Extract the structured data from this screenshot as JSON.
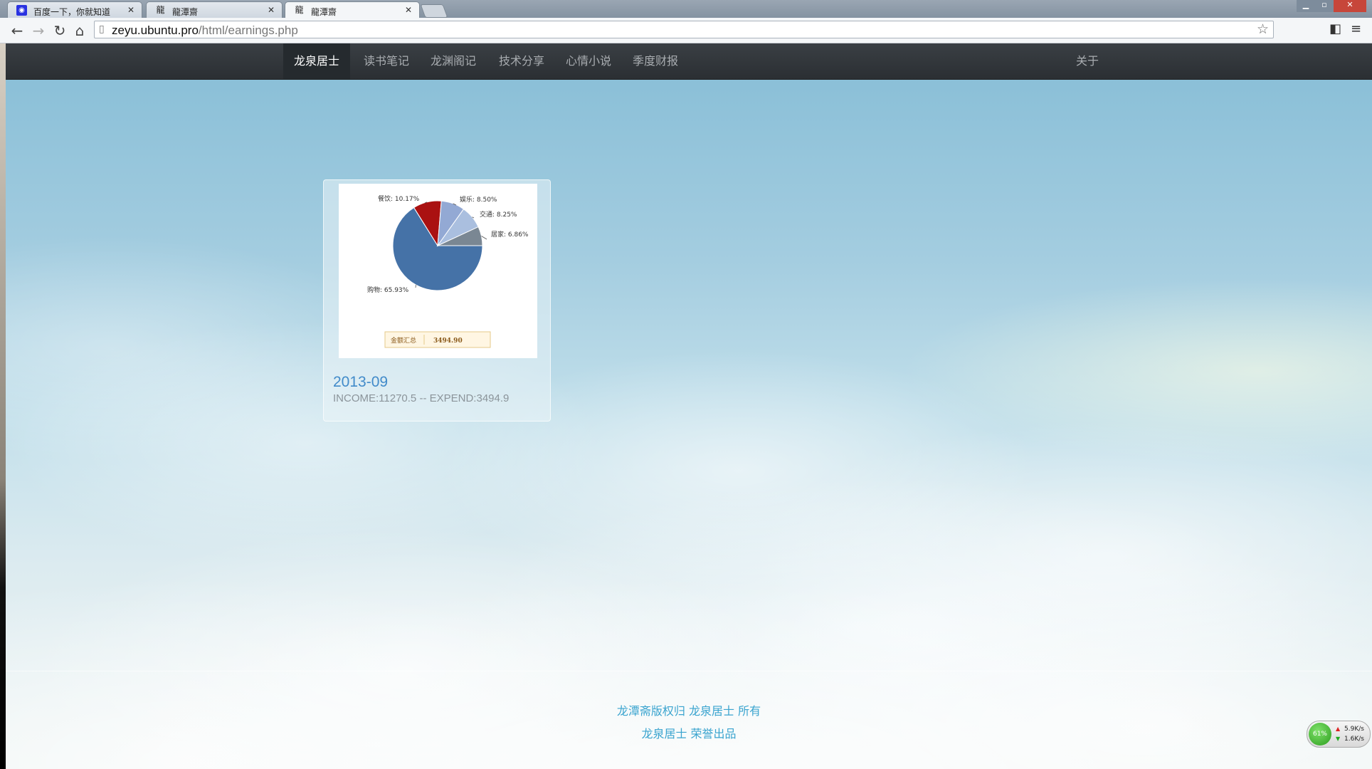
{
  "browser": {
    "tabs": [
      {
        "title": "百度一下，你就知道",
        "icon": "baidu-icon"
      },
      {
        "title": "龍潭齋",
        "icon": "dragon-logo-icon"
      },
      {
        "title": "龍潭齋",
        "icon": "dragon-logo-icon",
        "active": true
      }
    ],
    "url_host": "zeyu.ubuntu.pro",
    "url_path": "/html/earnings.php"
  },
  "nav": {
    "items": [
      "龙泉居士",
      "读书笔记",
      "龙渊阁记",
      "技术分享",
      "心情小说",
      "季度财报"
    ],
    "active_index": 0,
    "about": "关于"
  },
  "card": {
    "title": "2013-09",
    "income_label": "INCOME:11270.5",
    "separator": "--",
    "expend_label": "EXPEND:3494.9"
  },
  "chart_data": {
    "type": "pie",
    "slices": [
      {
        "label": "购物",
        "value": 65.93,
        "color": "#4572a7"
      },
      {
        "label": "餐饮",
        "value": 10.17,
        "color": "#aa1111"
      },
      {
        "label": "娱乐",
        "value": 8.5,
        "color": "#93a9d4"
      },
      {
        "label": "交通",
        "value": 8.25,
        "color": "#aabfdf"
      },
      {
        "label": "居家",
        "value": 6.86,
        "color": "#7a8793"
      }
    ],
    "slice_labels": [
      "购物: 65.93%",
      "餐饮: 10.17%",
      "娱乐: 8.50%",
      "交通: 8.25%",
      "居家: 6.86%"
    ],
    "total_label": "金额汇总",
    "total_value": "3494.90"
  },
  "footer": {
    "line1": "龙潭斋版权归 龙泉居士 所有",
    "line2": "龙泉居士 荣誉出品"
  },
  "netmeter": {
    "percent": "61%",
    "up": "5.9K/s",
    "down": "1.6K/s"
  }
}
